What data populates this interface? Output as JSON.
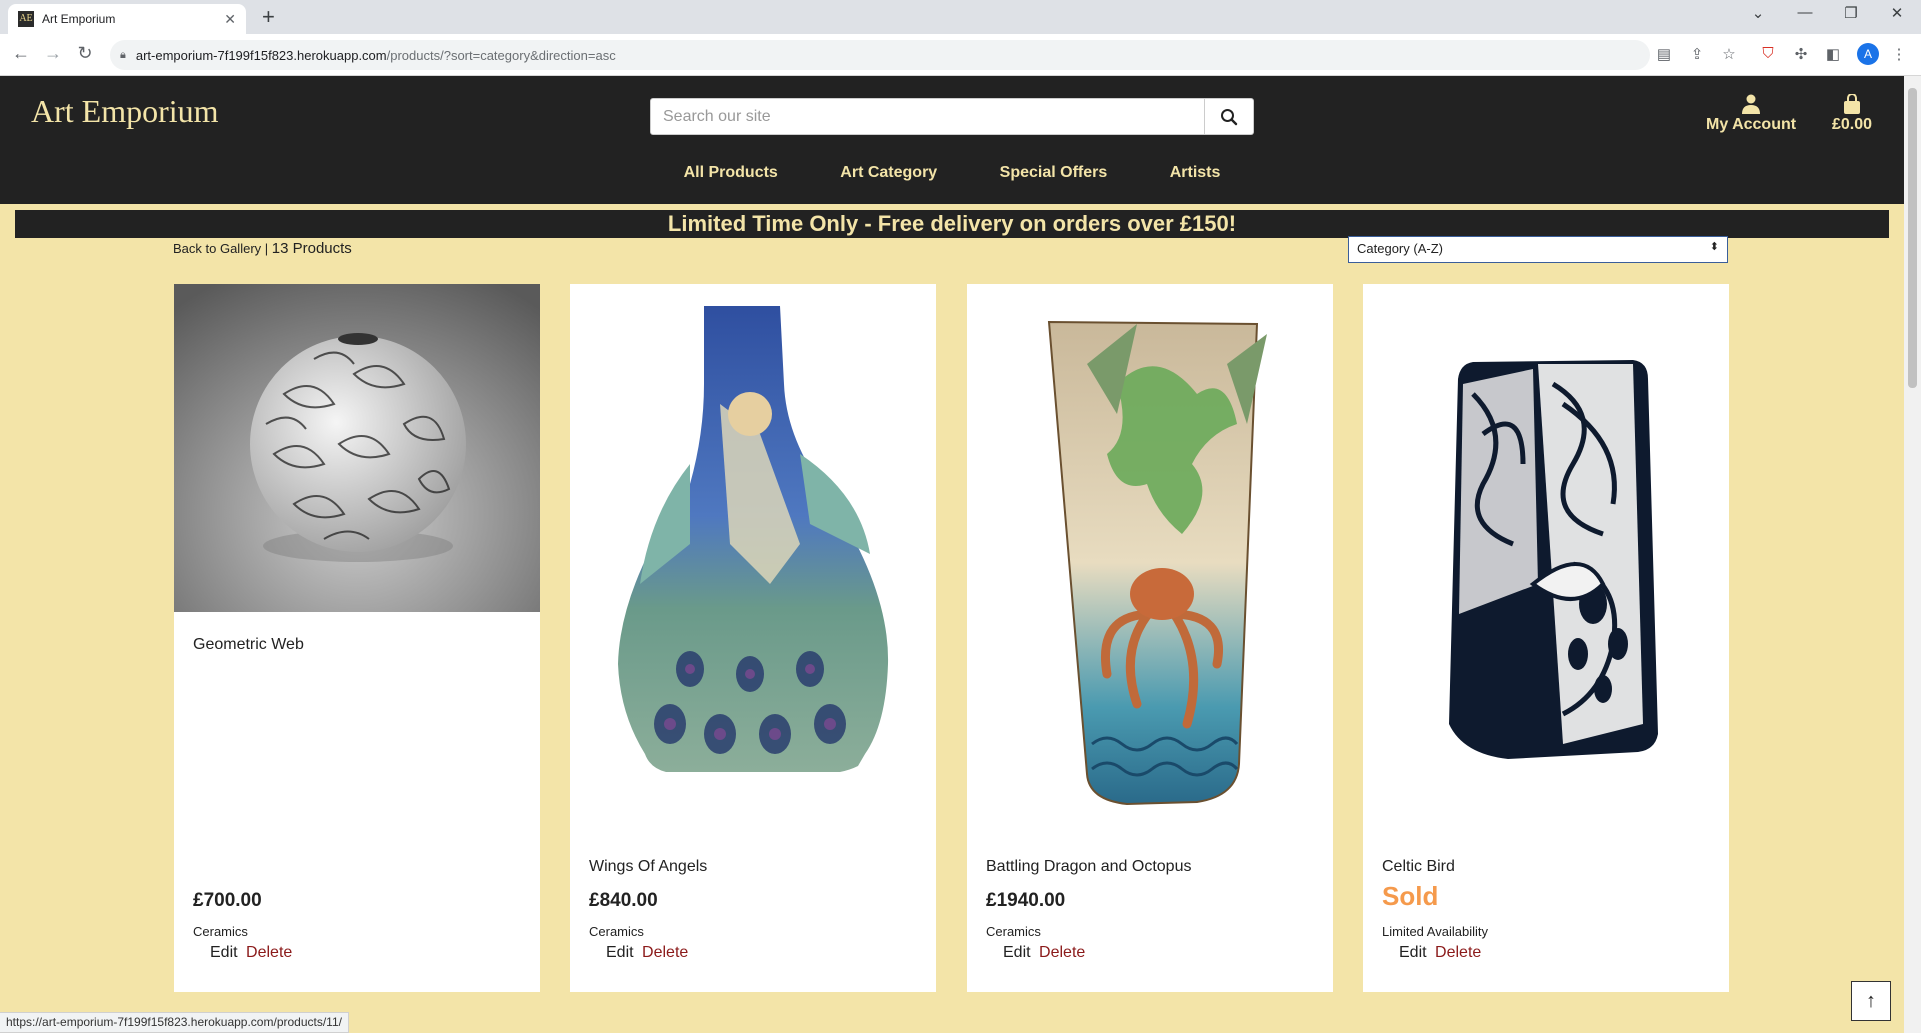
{
  "browser": {
    "tab_title": "Art Emporium",
    "tab_favicon": "AE",
    "url_host": "art-emporium-7f199f15f823.herokuapp.com",
    "url_path": "/products/?sort=category&direction=asc",
    "profile_initial": "A",
    "status_url": "https://art-emporium-7f199f15f823.herokuapp.com/products/11/"
  },
  "header": {
    "logo": "Art Emporium",
    "search_placeholder": "Search our site",
    "account_label": "My Account",
    "bag_total": "£0.00"
  },
  "nav": {
    "items": [
      "All Products",
      "Art Category",
      "Special Offers",
      "Artists"
    ]
  },
  "promo": "Limited Time Only - Free delivery on orders over £150!",
  "listing": {
    "back_link": "Back to Gallery",
    "separator": " | ",
    "count": "13 Products",
    "sort_value": "Category (A-Z)"
  },
  "products": [
    {
      "name": "Geometric Web",
      "price": "£700.00",
      "category": "Ceramics",
      "edit": "Edit",
      "delete": "Delete"
    },
    {
      "name": "Wings Of Angels",
      "price": "£840.00",
      "category": "Ceramics",
      "edit": "Edit",
      "delete": "Delete"
    },
    {
      "name": "Battling Dragon and Octopus",
      "price": "£1940.00",
      "category": "Ceramics",
      "edit": "Edit",
      "delete": "Delete"
    },
    {
      "name": "Celtic Bird",
      "sold": "Sold",
      "category": "Limited Availability",
      "edit": "Edit",
      "delete": "Delete"
    }
  ],
  "colors": {
    "page_bg": "#f3e4a8",
    "header_bg": "#222222",
    "accent_text": "#f3e4a8",
    "sold": "#f59a4c",
    "delete": "#8b1a1a"
  },
  "icons": {
    "search": "search-icon",
    "account": "user-icon",
    "bag": "shopping-bag-icon",
    "back_to_top": "arrow-up-icon"
  }
}
